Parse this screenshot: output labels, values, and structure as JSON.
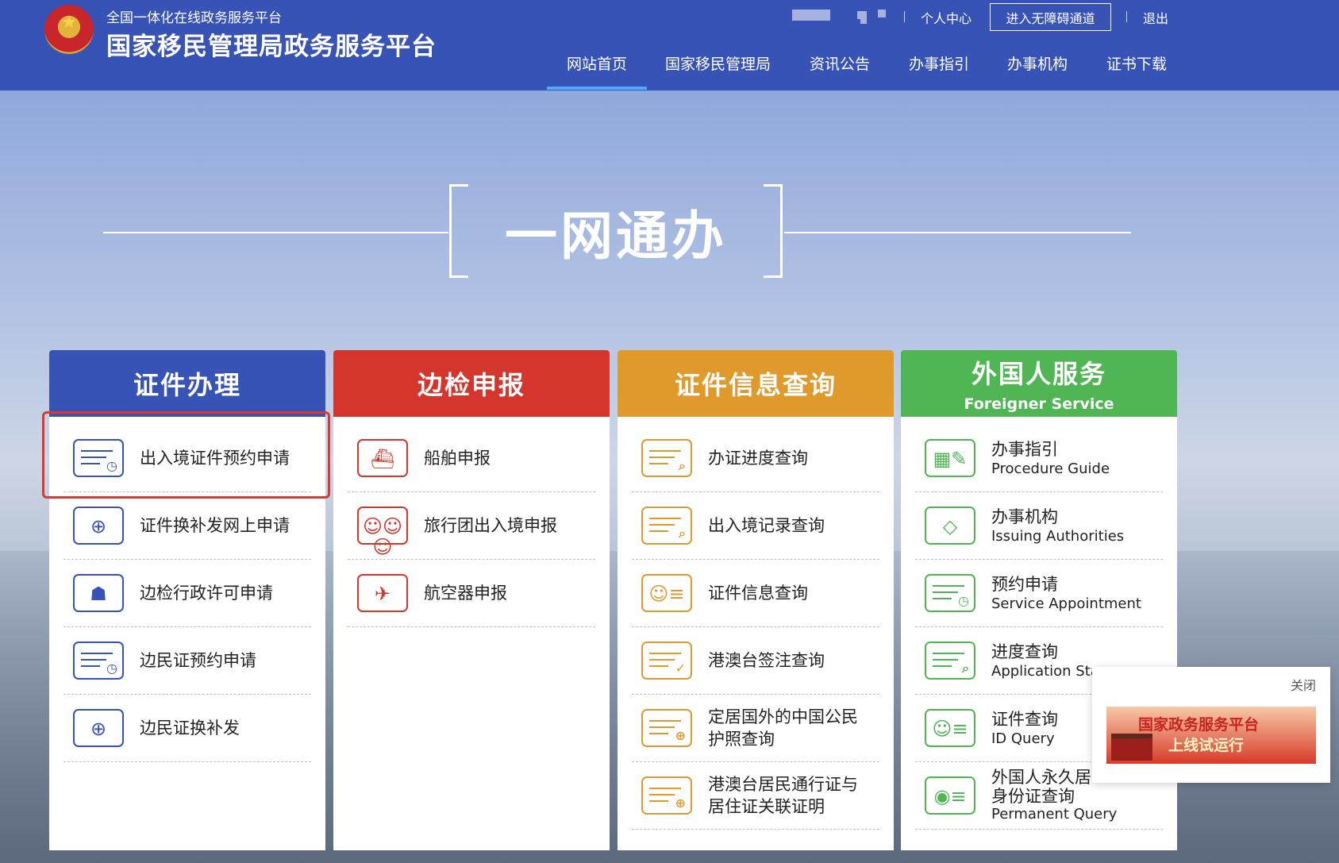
{
  "header": {
    "platform_subtitle": "全国一体化在线政务服务平台",
    "platform_title": "国家移民管理局政务服务平台",
    "top_links": {
      "personal_center": "个人中心",
      "accessibility": "进入无障碍通道",
      "logout": "退出"
    },
    "nav": [
      "网站首页",
      "国家移民管理局",
      "资讯公告",
      "办事指引",
      "办事机构",
      "证书下载"
    ],
    "nav_active": "网站首页"
  },
  "hero": {
    "title": "一网通办"
  },
  "cards": [
    {
      "title": "证件办理",
      "color": "#3853b6",
      "items": [
        {
          "label": "出入境证件预约申请",
          "icon": "appointment-icon"
        },
        {
          "label": "证件换补发网上申请",
          "icon": "globe-icon"
        },
        {
          "label": "边检行政许可申请",
          "icon": "officer-icon"
        },
        {
          "label": "边民证预约申请",
          "icon": "appointment-icon"
        },
        {
          "label": "边民证换补发",
          "icon": "globe-icon"
        }
      ]
    },
    {
      "title": "边检申报",
      "color": "#d4362c",
      "items": [
        {
          "label": "船舶申报",
          "icon": "ship-icon"
        },
        {
          "label": "旅行团出入境申报",
          "icon": "group-icon"
        },
        {
          "label": "航空器申报",
          "icon": "airplane-icon"
        }
      ]
    },
    {
      "title": "证件信息查询",
      "color": "#e09a2c",
      "items": [
        {
          "label": "办证进度查询",
          "icon": "document-search-icon"
        },
        {
          "label": "出入境记录查询",
          "icon": "document-search-icon"
        },
        {
          "label": "证件信息查询",
          "icon": "id-card-icon"
        },
        {
          "label": "港澳台签注查询",
          "icon": "document-check-icon"
        },
        {
          "label": "定居国外的中国公民护照查询",
          "icon": "document-globe-icon"
        },
        {
          "label": "港澳台居民通行证与居住证关联证明",
          "icon": "document-globe-icon"
        }
      ]
    },
    {
      "title": "外国人服务",
      "subtitle": "Foreigner Service",
      "color": "#4fb653",
      "items": [
        {
          "label": "办事指引",
          "en": "Procedure Guide",
          "icon": "building-icon"
        },
        {
          "label": "办事机构",
          "en": "Issuing Authorities",
          "icon": "compass-icon"
        },
        {
          "label": "预约申请",
          "en": "Service Appointment",
          "icon": "appointment-icon"
        },
        {
          "label": "进度查询",
          "en": "Application Sta",
          "icon": "document-search-icon"
        },
        {
          "label": "证件查询",
          "en": "ID Query",
          "icon": "id-card-icon"
        },
        {
          "label": "外国人永久居",
          "label2": "身份证查询",
          "en": "Permanent Query",
          "icon": "permanent-id-icon"
        }
      ]
    }
  ],
  "popup": {
    "close_label": "关闭",
    "banner_line1": "国家政务服务平台",
    "banner_line2": "上线试运行"
  }
}
